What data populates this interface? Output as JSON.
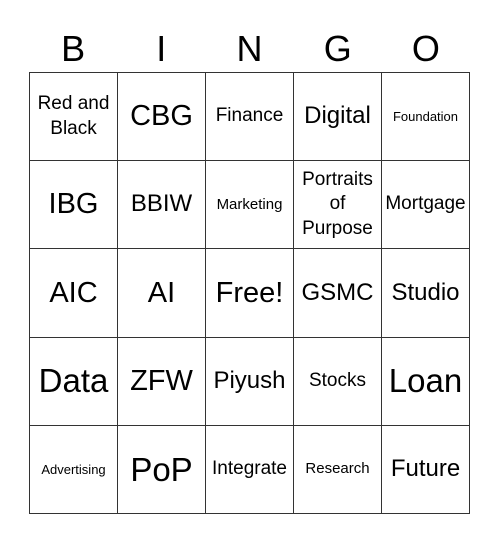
{
  "header": {
    "letters": [
      "B",
      "I",
      "N",
      "G",
      "O"
    ]
  },
  "board": {
    "rows": [
      [
        "Red and Black",
        "CBG",
        "Finance",
        "Digital",
        "Foundation"
      ],
      [
        "IBG",
        "BBIW",
        "Marketing",
        "Portraits of Purpose",
        "Mortgage"
      ],
      [
        "AIC",
        "AI",
        "Free!",
        "GSMC",
        "Studio"
      ],
      [
        "Data",
        "ZFW",
        "Piyush",
        "Stocks",
        "Loan"
      ],
      [
        "Advertising",
        "PoP",
        "Integrate",
        "Research",
        "Future"
      ]
    ]
  }
}
